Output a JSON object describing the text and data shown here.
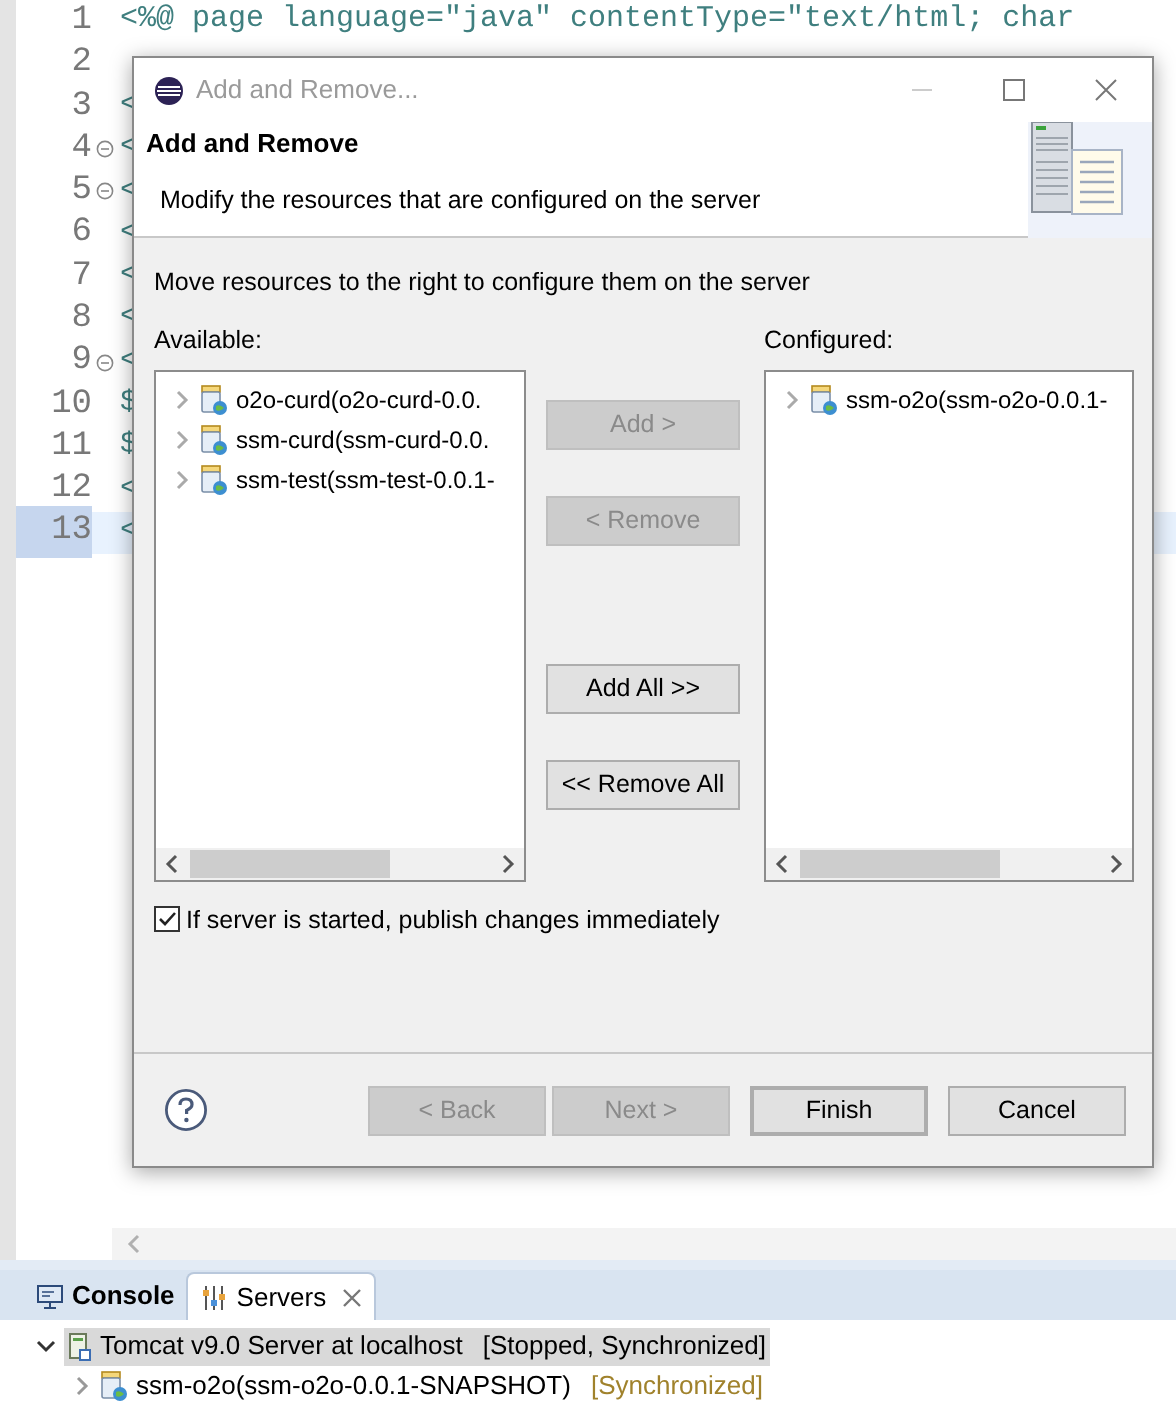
{
  "editor": {
    "lines": [
      {
        "number": "1",
        "text": "<%@ page language=\"java\" contentType=\"text/html; char",
        "foldable": false,
        "current": false
      },
      {
        "number": "2",
        "foldable": false,
        "current": false
      },
      {
        "number": "3",
        "text": "<",
        "foldable": false,
        "current": false
      },
      {
        "number": "4",
        "text": "<",
        "foldable": true,
        "current": false
      },
      {
        "number": "5",
        "text": "<",
        "foldable": true,
        "current": false
      },
      {
        "number": "6",
        "text": "<",
        "foldable": false,
        "current": false
      },
      {
        "number": "7",
        "text": "<",
        "foldable": false,
        "current": false
      },
      {
        "number": "8",
        "text": "<",
        "foldable": false,
        "current": false
      },
      {
        "number": "9",
        "text": "<",
        "foldable": true,
        "current": false
      },
      {
        "number": "10",
        "text": "$",
        "foldable": false,
        "current": false
      },
      {
        "number": "11",
        "text": "$",
        "foldable": false,
        "current": false
      },
      {
        "number": "12",
        "text": "<",
        "foldable": false,
        "current": false
      },
      {
        "number": "13",
        "text": "<",
        "foldable": false,
        "current": true
      }
    ]
  },
  "dialog": {
    "title": "Add and Remove...",
    "heading": "Add and Remove",
    "description": "Modify the resources that are configured on the server",
    "instruction": "Move resources to the right to configure them on the server",
    "available_label": "Available:",
    "available_items": [
      {
        "label": "o2o-curd(o2o-curd-0.0."
      },
      {
        "label": "ssm-curd(ssm-curd-0.0."
      },
      {
        "label": "ssm-test(ssm-test-0.0.1-"
      }
    ],
    "configured_label": "Configured:",
    "configured_items": [
      {
        "label": "ssm-o2o(ssm-o2o-0.0.1-"
      }
    ],
    "transfer_buttons": [
      {
        "label": "Add >",
        "disabled": true
      },
      {
        "label": "< Remove",
        "disabled": true
      },
      {
        "label": "Add All >>",
        "disabled": false
      },
      {
        "label": "<< Remove All",
        "disabled": false
      }
    ],
    "publish_checkbox": {
      "label": "If server is started, publish changes immediately",
      "checked": true
    },
    "footer_buttons": [
      {
        "label": "< Back",
        "disabled": true,
        "default": false
      },
      {
        "label": "Next >",
        "disabled": true,
        "default": false
      },
      {
        "label": "Finish",
        "disabled": false,
        "default": true
      },
      {
        "label": "Cancel",
        "disabled": false,
        "default": false
      }
    ]
  },
  "bottom_panel": {
    "tabs": [
      {
        "label": "Console",
        "selected": false,
        "closable": false
      },
      {
        "label": "Servers",
        "selected": true,
        "closable": true
      }
    ],
    "servers": [
      {
        "label": "Tomcat v9.0 Server at localhost",
        "status": "[Stopped, Synchronized]",
        "expanded": true,
        "selected": true,
        "children": [
          {
            "label": "ssm-o2o(ssm-o2o-0.0.1-SNAPSHOT)",
            "status": "[Synchronized]"
          }
        ]
      }
    ]
  }
}
